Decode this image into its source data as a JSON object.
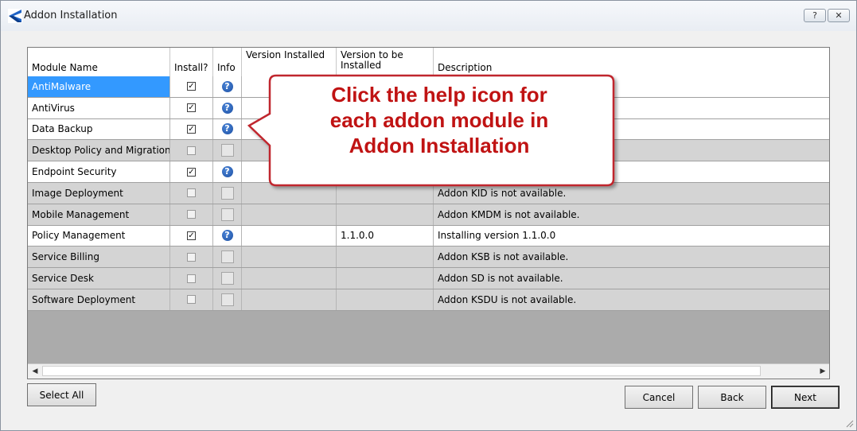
{
  "window": {
    "title": "Addon Installation",
    "help_button": "?",
    "close_button": "✕"
  },
  "grid": {
    "headers": {
      "module_name": "Module Name",
      "install": "Install?",
      "info": "Info",
      "version_installed": "Version Installed",
      "version_to_be_installed": "Version to be Installed",
      "description": "Description"
    },
    "rows": [
      {
        "name": "AntiMalware",
        "install": true,
        "info": "?",
        "version_installed": "",
        "version_to_be": "",
        "description": ""
      },
      {
        "name": "AntiVirus",
        "install": true,
        "info": "?",
        "version_installed": "",
        "version_to_be": "",
        "description": ""
      },
      {
        "name": "Data Backup",
        "install": true,
        "info": "?",
        "version_installed": "",
        "version_to_be": "",
        "description": ""
      },
      {
        "name": "Desktop Policy and Migration",
        "install": false,
        "info": "",
        "version_installed": "",
        "version_to_be": "",
        "description": ""
      },
      {
        "name": "Endpoint Security",
        "install": true,
        "info": "?",
        "version_installed": "",
        "version_to_be": "",
        "description": ""
      },
      {
        "name": "Image Deployment",
        "install": false,
        "info": "",
        "version_installed": "",
        "version_to_be": "",
        "description": "Addon KID is not available."
      },
      {
        "name": "Mobile Management",
        "install": false,
        "info": "",
        "version_installed": "",
        "version_to_be": "",
        "description": "Addon KMDM is not available."
      },
      {
        "name": "Policy Management",
        "install": true,
        "info": "?",
        "version_installed": "",
        "version_to_be": "1.1.0.0",
        "description": "Installing version 1.1.0.0"
      },
      {
        "name": "Service Billing",
        "install": false,
        "info": "",
        "version_installed": "",
        "version_to_be": "",
        "description": "Addon KSB is not available."
      },
      {
        "name": "Service Desk",
        "install": false,
        "info": "",
        "version_installed": "",
        "version_to_be": "",
        "description": "Addon SD is not available."
      },
      {
        "name": "Software Deployment",
        "install": false,
        "info": "",
        "version_installed": "",
        "version_to_be": "",
        "description": "Addon KSDU is not available."
      }
    ],
    "selected_row": "AntiMalware",
    "check_mark": "✓",
    "scroll_left": "◀",
    "scroll_right": "▶"
  },
  "buttons": {
    "select_all": "Select All",
    "cancel": "Cancel",
    "back": "Back",
    "next": "Next"
  },
  "callout": {
    "line1": "Click the help icon for",
    "line2": "each addon module in",
    "line3": "Addon Installation"
  },
  "colors": {
    "selection": "#3399ff",
    "callout_text": "#c01313",
    "callout_border": "#c0282d",
    "info_icon": "#1c4fa3",
    "disabled_row": "#d4d4d4"
  }
}
